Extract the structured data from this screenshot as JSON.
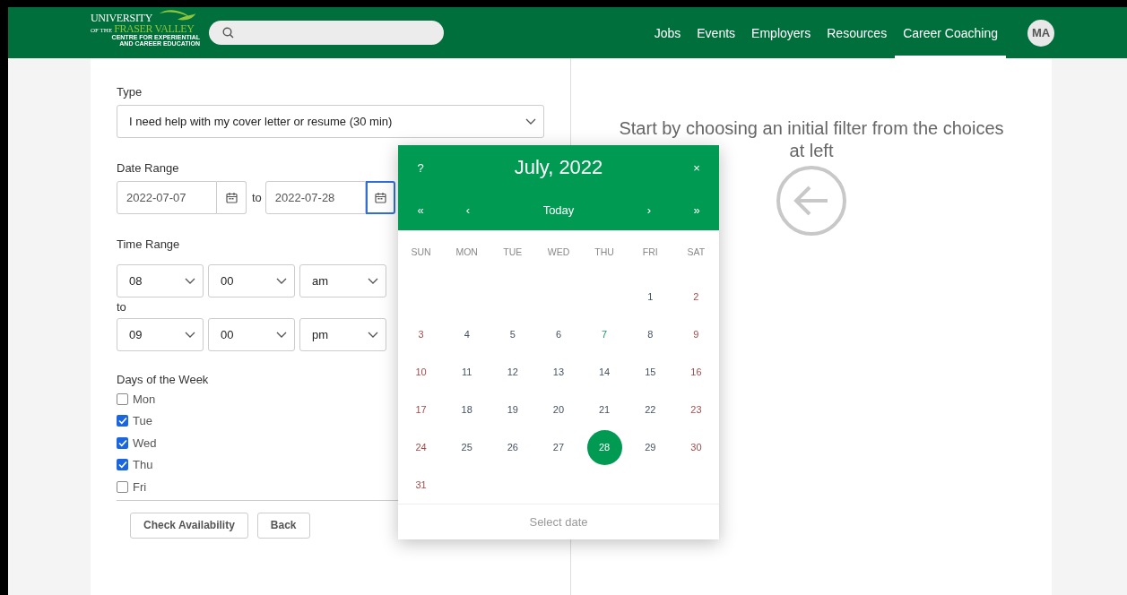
{
  "header": {
    "logo": {
      "line1": "UNIVERSITY",
      "prefix": "OF THE",
      "line2": "FRASER VALLEY",
      "tagline": [
        "CENTRE FOR EXPERIENTIAL",
        "AND CAREER EDUCATION"
      ]
    },
    "nav": [
      {
        "label": "Jobs",
        "selected": false
      },
      {
        "label": "Events",
        "selected": false
      },
      {
        "label": "Employers",
        "selected": false
      },
      {
        "label": "Resources",
        "selected": false
      },
      {
        "label": "Career Coaching",
        "selected": true
      }
    ],
    "avatar": "MA"
  },
  "form": {
    "type": {
      "label": "Type",
      "value": "I need help with my cover letter or resume (30 min)"
    },
    "date_range": {
      "label": "Date Range",
      "from": {
        "value": "2022-07-07",
        "focused": false
      },
      "separator": "to",
      "to": {
        "value": "2022-07-28",
        "focused": true
      }
    },
    "time_range": {
      "label": "Time Range",
      "from": [
        "08",
        "00",
        "am"
      ],
      "separator": "to",
      "to": [
        "09",
        "00",
        "pm"
      ]
    },
    "days": {
      "label": "Days of the Week",
      "items": [
        {
          "label": "Mon",
          "checked": false
        },
        {
          "label": "Tue",
          "checked": true
        },
        {
          "label": "Wed",
          "checked": true
        },
        {
          "label": "Thu",
          "checked": true
        },
        {
          "label": "Fri",
          "checked": false
        }
      ]
    },
    "buttons": [
      "Check Availability",
      "Back"
    ]
  },
  "hint": "Start by choosing an initial filter from the choices at left",
  "calendar": {
    "help": "?",
    "title": "July, 2022",
    "close": "×",
    "nav": [
      "«",
      "‹",
      "Today",
      "›",
      "»"
    ],
    "weekdays": [
      "SUN",
      "MON",
      "TUE",
      "WED",
      "THU",
      "FRI",
      "SAT"
    ],
    "weeks": [
      {
        "kind": "end_aligned",
        "days": [
          {
            "label": "1",
            "kind": "weekday",
            "selected": false
          },
          {
            "label": "2",
            "kind": "weekend",
            "selected": false
          }
        ]
      },
      {
        "kind": "start_aligned",
        "days": [
          {
            "label": "3",
            "kind": "weekend",
            "selected": false
          },
          {
            "label": "4",
            "kind": "weekday",
            "selected": false
          },
          {
            "label": "5",
            "kind": "weekday",
            "selected": false
          },
          {
            "label": "6",
            "kind": "weekday",
            "selected": false
          },
          {
            "label": "7",
            "kind": "today",
            "selected": false
          },
          {
            "label": "8",
            "kind": "weekday",
            "selected": false
          },
          {
            "label": "9",
            "kind": "weekend",
            "selected": false
          }
        ]
      },
      {
        "kind": "start_aligned",
        "days": [
          {
            "label": "10",
            "kind": "weekend",
            "selected": false
          },
          {
            "label": "11",
            "kind": "weekday",
            "selected": false
          },
          {
            "label": "12",
            "kind": "weekday",
            "selected": false
          },
          {
            "label": "13",
            "kind": "weekday",
            "selected": false
          },
          {
            "label": "14",
            "kind": "weekday",
            "selected": false
          },
          {
            "label": "15",
            "kind": "weekday",
            "selected": false
          },
          {
            "label": "16",
            "kind": "weekend",
            "selected": false
          }
        ]
      },
      {
        "kind": "start_aligned",
        "days": [
          {
            "label": "17",
            "kind": "weekend",
            "selected": false
          },
          {
            "label": "18",
            "kind": "weekday",
            "selected": false
          },
          {
            "label": "19",
            "kind": "weekday",
            "selected": false
          },
          {
            "label": "20",
            "kind": "weekday",
            "selected": false
          },
          {
            "label": "21",
            "kind": "weekday",
            "selected": false
          },
          {
            "label": "22",
            "kind": "weekday",
            "selected": false
          },
          {
            "label": "23",
            "kind": "weekend",
            "selected": false
          }
        ]
      },
      {
        "kind": "start_aligned",
        "days": [
          {
            "label": "24",
            "kind": "weekend",
            "selected": false
          },
          {
            "label": "25",
            "kind": "weekday",
            "selected": false
          },
          {
            "label": "26",
            "kind": "weekday",
            "selected": false
          },
          {
            "label": "27",
            "kind": "weekday",
            "selected": false
          },
          {
            "label": "28",
            "kind": "weekday",
            "selected": true
          },
          {
            "label": "29",
            "kind": "weekday",
            "selected": false
          },
          {
            "label": "30",
            "kind": "weekend",
            "selected": false
          }
        ]
      },
      {
        "kind": "start_aligned",
        "days": [
          {
            "label": "31",
            "kind": "weekend",
            "selected": false
          }
        ]
      }
    ],
    "footer": "Select date"
  }
}
